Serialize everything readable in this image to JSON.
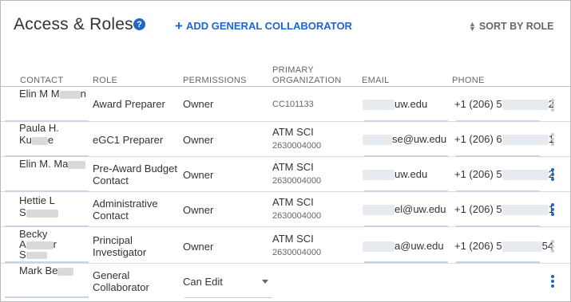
{
  "header": {
    "title": "Access & Roles",
    "help_icon": "?",
    "add_label": "ADD GENERAL COLLABORATOR",
    "add_icon": "+",
    "sort_label": "SORT BY ROLE"
  },
  "columns": {
    "contact": "CONTACT",
    "role": "ROLE",
    "permissions": "PERMISSIONS",
    "org": "PRIMARY ORGANIZATION",
    "email": "EMAIL",
    "phone": "PHONE"
  },
  "rows": [
    {
      "contact1": "Elin M M",
      "contact2": "n",
      "role": "Award Preparer",
      "permissions": "Owner",
      "org": "",
      "org_code": "CC101133",
      "email": "uw.edu",
      "phone": "+1 (206) 5",
      "phone_end": "2"
    },
    {
      "contact1": "Paula H.",
      "contact2": "Ku",
      "contact3": "e",
      "role": "eGC1 Preparer",
      "permissions": "Owner",
      "org": "ATM SCI",
      "org_code": "2630004000",
      "email": "se@uw.edu",
      "phone": "+1 (206) 6",
      "phone_end": "1"
    },
    {
      "contact1": "Elin M. Ma",
      "role": "Pre-Award Budget Contact",
      "permissions": "Owner",
      "org": "ATM SCI",
      "org_code": "2630004000",
      "email": "uw.edu",
      "phone": "+1 (206) 5",
      "phone_end": "2"
    },
    {
      "contact1": "Hettie L",
      "contact2": "S",
      "role": "Administrative Contact",
      "permissions": "Owner",
      "org": "ATM SCI",
      "org_code": "2630004000",
      "email": "el@uw.edu",
      "phone": "+1 (206) 5",
      "phone_end": "1"
    },
    {
      "contact1": "Becky",
      "contact2": "A",
      "contact2b": "r",
      "contact3": "S",
      "role": "Principal Investigator",
      "permissions": "Owner",
      "org": "ATM SCI",
      "org_code": "2630004000",
      "email": "a@uw.edu",
      "phone": "+1 (206) 5",
      "phone_end": "54"
    },
    {
      "contact1": "Mark Be",
      "role": "General Collaborator",
      "permissions": "Can Edit",
      "org": "",
      "org_code": "",
      "email": "",
      "phone": "",
      "phone_end": ""
    }
  ]
}
